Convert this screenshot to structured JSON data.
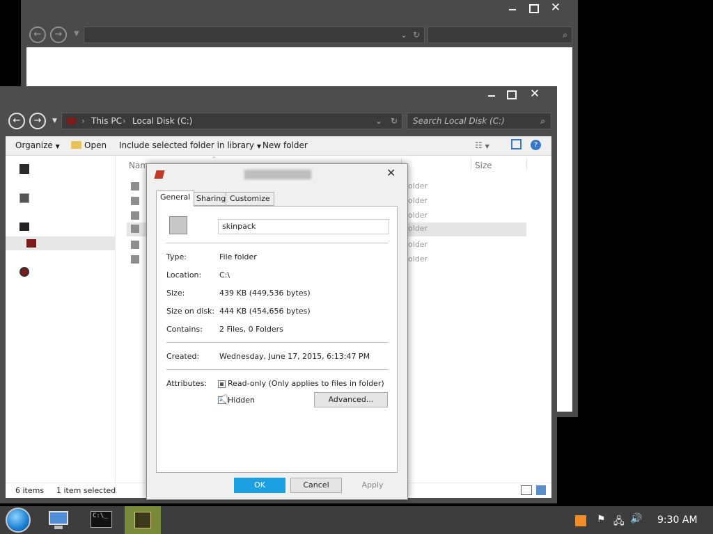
{
  "back_window": {},
  "main_window": {
    "breadcrumb": [
      "This PC",
      "Local Disk (C:)"
    ],
    "search_placeholder": "Search Local Disk (C:)",
    "toolbar": {
      "organize": "Organize",
      "open": "Open",
      "include": "Include selected folder in library",
      "new_folder": "New folder"
    },
    "columns": {
      "name": "Nam",
      "size": "Size"
    },
    "file_rows": [
      {
        "type": "older"
      },
      {
        "type": "older"
      },
      {
        "type": "older"
      },
      {
        "type": "older"
      },
      {
        "type": "older"
      },
      {
        "type": "older"
      }
    ],
    "status": {
      "count": "6 items",
      "selected": "1 item selected"
    }
  },
  "dialog": {
    "tabs": [
      "General",
      "Sharing",
      "Customize"
    ],
    "folder_name": "skinpack",
    "rows": {
      "type": {
        "label": "Type:",
        "value": "File folder"
      },
      "location": {
        "label": "Location:",
        "value": "C:\\"
      },
      "size": {
        "label": "Size:",
        "value": "439 KB (449,536 bytes)"
      },
      "size_on_disk": {
        "label": "Size on disk:",
        "value": "444 KB (454,656 bytes)"
      },
      "contains": {
        "label": "Contains:",
        "value": "2 Files, 0 Folders"
      },
      "created": {
        "label": "Created:",
        "value": "Wednesday, June 17, 2015, 6:13:47 PM"
      }
    },
    "attributes_label": "Attributes:",
    "readonly_label": "Read-only (Only applies to files in folder)",
    "hidden_label": "Hidden",
    "advanced_button": "Advanced...",
    "ok_button": "OK",
    "cancel_button": "Cancel",
    "apply_button": "Apply"
  },
  "taskbar": {
    "clock": "9:30 AM"
  }
}
